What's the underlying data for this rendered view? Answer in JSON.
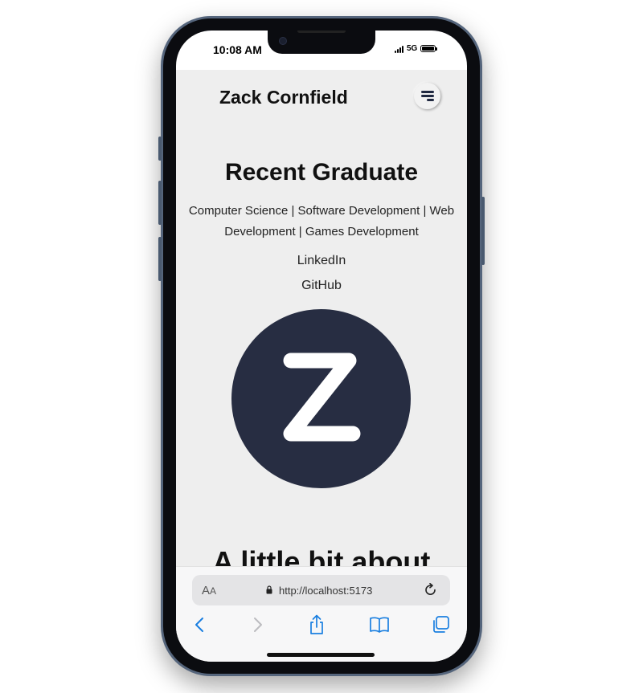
{
  "status": {
    "time": "10:08 AM",
    "network": "5G"
  },
  "site": {
    "title": "Zack Cornfield",
    "hero_title": "Recent Graduate",
    "hero_subtitle": "Computer Science | Software Development | Web Development | Games Development",
    "links": [
      "LinkedIn",
      "GitHub"
    ],
    "logo_letter": "Z",
    "section_heading": "A little bit about"
  },
  "browser": {
    "text_size_label_big": "A",
    "text_size_label_small": "A",
    "url": "http://localhost:5173",
    "icons": [
      "back-icon",
      "forward-icon",
      "share-icon",
      "bookmarks-icon",
      "tabs-icon",
      "reload-icon",
      "lock-icon"
    ]
  },
  "colors": {
    "page_background": "#eeeeee",
    "logo_background": "#272d42",
    "accent_blue": "#1a7fe0"
  }
}
